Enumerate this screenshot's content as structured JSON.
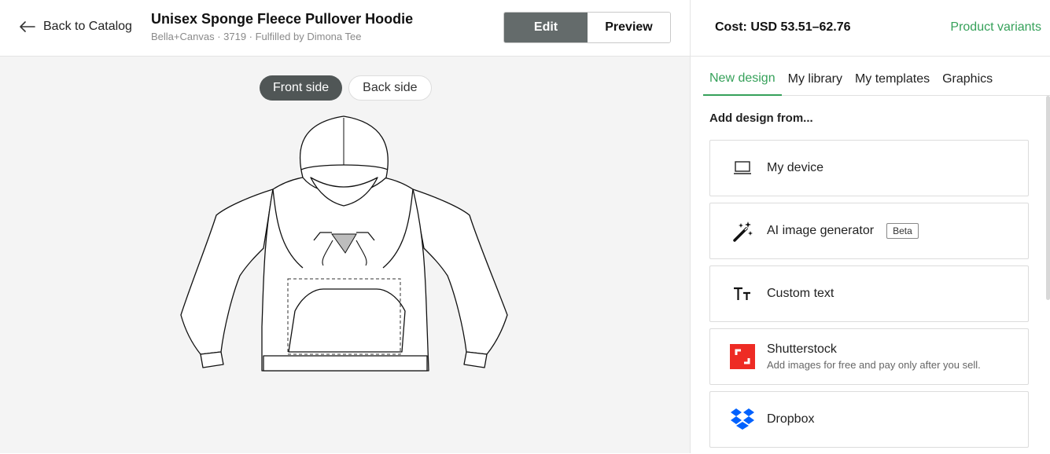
{
  "header": {
    "back_label": "Back to Catalog",
    "title": "Unisex Sponge Fleece Pullover Hoodie",
    "subtitle": "Bella+Canvas · 3719 · Fulfilled by Dimona Tee",
    "edit_label": "Edit",
    "preview_label": "Preview",
    "cost": "Cost: USD 53.51–62.76",
    "variants_label": "Product variants"
  },
  "canvas": {
    "front_label": "Front side",
    "back_label": "Back side"
  },
  "panel": {
    "tabs": [
      {
        "label": "New design",
        "active": true
      },
      {
        "label": "My library"
      },
      {
        "label": "My templates"
      },
      {
        "label": "Graphics"
      }
    ],
    "add_from": "Add design from...",
    "sources": [
      {
        "label": "My device",
        "icon": "laptop-icon"
      },
      {
        "label": "AI image generator",
        "icon": "magic-wand-icon",
        "badge": "Beta"
      },
      {
        "label": "Custom text",
        "icon": "text-icon"
      },
      {
        "label": "Shutterstock",
        "icon": "shutterstock-icon",
        "sub": "Add images for free and pay only after you sell."
      },
      {
        "label": "Dropbox",
        "icon": "dropbox-icon"
      }
    ]
  },
  "colors": {
    "accent": "#36a15a",
    "segment_active": "#646b6b",
    "shutterstock": "#ee2b24",
    "dropbox": "#0061fe"
  }
}
